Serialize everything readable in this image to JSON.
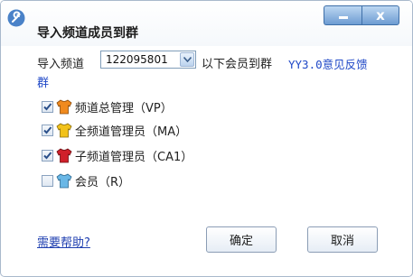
{
  "dialog": {
    "title": "导入频道成员到群",
    "icon": "wrench-icon"
  },
  "window_controls": {
    "minimize_icon": "minimize-icon",
    "close_icon": "close-icon",
    "close_glyph": "x"
  },
  "import_row": {
    "label": "导入频道",
    "channel_id": "122095801",
    "middle_text": "以下会员到群",
    "group_name": "YY3.0意见反馈",
    "group_suffix": "群"
  },
  "roles": [
    {
      "label": "频道总管理（VP）",
      "checked": true,
      "shirt_color": "#f08a1e",
      "icon": "orange-shirt-icon"
    },
    {
      "label": "全频道管理员（MA）",
      "checked": true,
      "shirt_color": "#f2c21a",
      "icon": "yellow-shirt-icon"
    },
    {
      "label": "子频道管理员（CA1）",
      "checked": true,
      "shirt_color": "#d0202a",
      "icon": "red-shirt-icon"
    },
    {
      "label": "会员（R）",
      "checked": false,
      "shirt_color": "#69b7e6",
      "icon": "blue-shirt-icon"
    }
  ],
  "footer": {
    "help_link": "需要帮助?",
    "ok_label": "确定",
    "cancel_label": "取消"
  }
}
